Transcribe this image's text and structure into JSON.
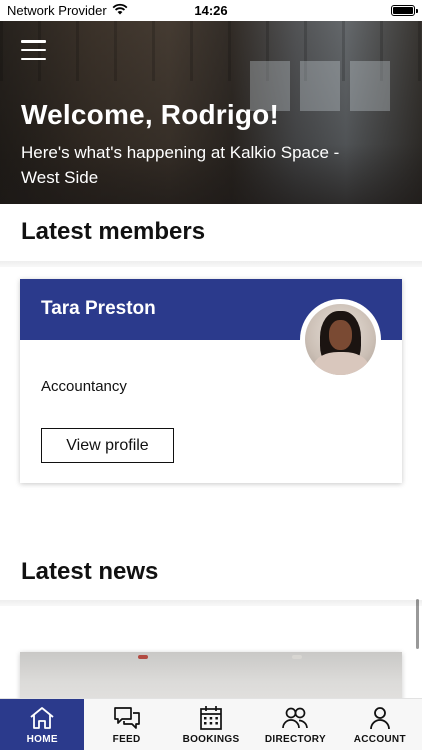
{
  "status_bar": {
    "carrier": "Network Provider",
    "time": "14:26",
    "battery_level": 1.0
  },
  "hero": {
    "title": "Welcome, Rodrigo!",
    "subtitle": "Here's what's happening at Kalkio Space - West Side"
  },
  "sections": {
    "latest_members": "Latest members",
    "latest_news": "Latest news"
  },
  "member_card": {
    "name": "Tara Preston",
    "role": "Accountancy",
    "button_label": "View profile"
  },
  "tab_bar": {
    "items": [
      {
        "label": "HOME",
        "icon": "home-icon",
        "active": true
      },
      {
        "label": "FEED",
        "icon": "chat-bubbles-icon",
        "active": false
      },
      {
        "label": "BOOKINGS",
        "icon": "calendar-icon",
        "active": false
      },
      {
        "label": "DIRECTORY",
        "icon": "people-icon",
        "active": false
      },
      {
        "label": "ACCOUNT",
        "icon": "user-icon",
        "active": false
      }
    ]
  },
  "colors": {
    "brand_blue": "#2b3a8c",
    "tab_bar_bg": "#f7f7f7",
    "text": "#111111"
  }
}
